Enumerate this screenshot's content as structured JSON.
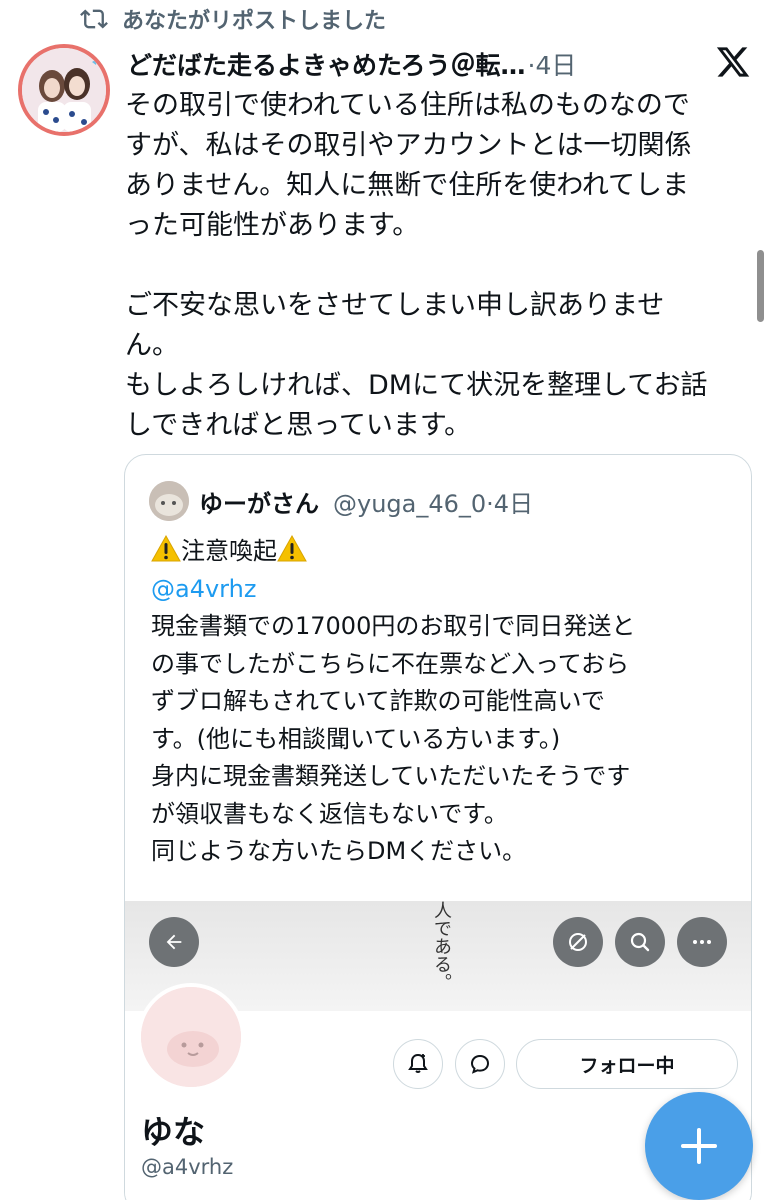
{
  "repost": {
    "text": "あなたがリポストしました",
    "icon": "repost-icon"
  },
  "tweet": {
    "author_name": "どだばた走るよきゃめたろう＠転…",
    "meta": "·4日",
    "logo": "x-logo",
    "body": {
      "p1_line1": "その取引で使われている住所は私のものなので",
      "p1_line2": "すが、私はその取引やアカウントとは一切関係",
      "p1_line3": "ありません。知人に無断で住所を使われてしま",
      "p1_line4": "った可能性があります。",
      "p2_line1": "ご不安な思いをさせてしまい申し訳ありませ",
      "p2_line2": "ん。",
      "p3_line1": "もしよろしければ、DMにて状況を整理してお話",
      "p3_line2": "しできればと思っています。"
    }
  },
  "quote": {
    "author_name": "ゆーがさん",
    "handle_meta": "@yuga_46_0·4日",
    "heading": "注意喚起",
    "warning_icon": "warning-icon",
    "mention": "@a4vrhz",
    "lines": [
      "現金書類での17000円のお取引で同日発送と",
      "の事でしたがこちらに不在票など入っておら",
      "ずブロ解もされていて詐欺の可能性高いで",
      "す。(他にも相談聞いている方います。)",
      "身内に現金書類発送していただいたそうです",
      "が領収書もなく返信もないです。",
      "同じような方いたらDMください。"
    ]
  },
  "embedded_profile": {
    "banner_text": "人である。",
    "follow_label": "フォロー中",
    "name": "ゆな",
    "handle": "@a4vrhz",
    "icons": [
      "back-arrow-icon",
      "grok-icon",
      "search-icon",
      "more-icon",
      "notification-bell-icon",
      "message-icon"
    ]
  },
  "fab": {
    "icon": "plus-icon"
  },
  "colors": {
    "accent": "#1d9bf0",
    "fab": "#4a9fe8",
    "secondary_text": "#536471",
    "avatar_border": "#e8716b"
  }
}
